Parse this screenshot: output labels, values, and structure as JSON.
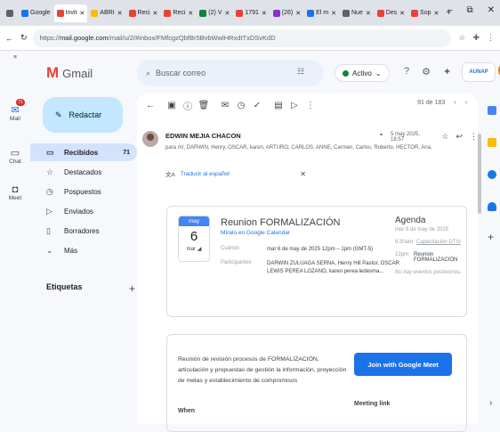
{
  "browser": {
    "tabs": [
      {
        "label": "",
        "color": "#5f6368"
      },
      {
        "label": "Google",
        "color": "#1a73e8"
      },
      {
        "label": "Invit",
        "color": "#ea4335"
      },
      {
        "label": "ABRI",
        "color": "#fbbc04"
      },
      {
        "label": "Reci",
        "color": "#ea4335"
      },
      {
        "label": "Reci",
        "color": "#ea4335"
      },
      {
        "label": "(2) V",
        "color": "#188038"
      },
      {
        "label": "1791",
        "color": "#ea4335"
      },
      {
        "label": "(26)",
        "color": "#8430ce"
      },
      {
        "label": "El m",
        "color": "#1a73e8"
      },
      {
        "label": "Nue",
        "color": "#5f6368"
      },
      {
        "label": "Des",
        "color": "#ea4335"
      },
      {
        "label": "Sop",
        "color": "#ea4335"
      }
    ],
    "new_tab": "+",
    "url_prefix": "https://",
    "url_domain": "mail.google.com",
    "url_path": "/mail/u/2/#inbox/FMfcgzQbfBr5BvbWwlHRxdtTxDSvKdD"
  },
  "leftbar": {
    "mail_label": "Mail",
    "mail_badge": "71",
    "chat_label": "Chat",
    "meet_label": "Meet"
  },
  "header": {
    "app_name": "Gmail",
    "search_placeholder": "Buscar correo",
    "status_label": "Activo",
    "org_label": "AUNAP",
    "avatar_letter": "D"
  },
  "nav": {
    "compose_label": "Redactar",
    "items": [
      {
        "icon": "inbox-icon",
        "glyph": "▭",
        "label": "Recibidos",
        "count": "71",
        "active": true
      },
      {
        "icon": "star-icon",
        "glyph": "☆",
        "label": "Destacados",
        "count": "",
        "active": false
      },
      {
        "icon": "clock-icon",
        "glyph": "◷",
        "label": "Pospuestos",
        "count": "",
        "active": false
      },
      {
        "icon": "send-icon",
        "glyph": "▷",
        "label": "Enviados",
        "count": "",
        "active": false
      },
      {
        "icon": "draft-icon",
        "glyph": "▯",
        "label": "Borradores",
        "count": "",
        "active": false
      },
      {
        "icon": "chevron-down-icon",
        "glyph": "⌄",
        "label": "Más",
        "count": "",
        "active": false
      }
    ],
    "labels_title": "Etiquetas"
  },
  "message": {
    "pager": "91 de 183",
    "sender": "EDWIN MEJIA CHACON",
    "recipients": "para mí, DARWIN, Henry, OSCAR, karen, ARTURO, CARLOS, ANNE, Carmen, Carlos, Roberto, HECTOR, Ana, Yairton, Federico ▾",
    "date": "5 may 2025, 18:57",
    "translate": "Traducir al español"
  },
  "event": {
    "month": "may",
    "day": "6",
    "weekday_short": "mar",
    "title": "Reunion FORMALIZACIÓN",
    "calendar_link": "Míralo en Google Calendar",
    "when_label": "Cuándo",
    "when_value": "mar 6 de may de 2025 12pm – 1pm (GMT-5)",
    "participants_label": "Participantes",
    "participants_value": "DARWIN ZULUAGA SERNA, Henry Hill Pastor, OSCAR LEWIS PEREA LOZANO, karen perea ledesma...",
    "agenda_title": "Agenda",
    "agenda_date": "mar 6 de may de 2025",
    "agenda_items": [
      {
        "time": "9:30am",
        "name": "Capacitación DTIV"
      },
      {
        "time": "12pm",
        "name": "Reunion FORMALIZACIÓN"
      }
    ],
    "agenda_none": "No hay eventos posteriores."
  },
  "description": {
    "text": "Reunión de revisión procesos de FORMALIZACIÓN, articulación y propuestas de gestión la información, proyección de metas y establecimiento de compromisos",
    "join_label": "Join with Google Meet",
    "when_heading": "When",
    "meet_link_heading": "Meeting link"
  }
}
